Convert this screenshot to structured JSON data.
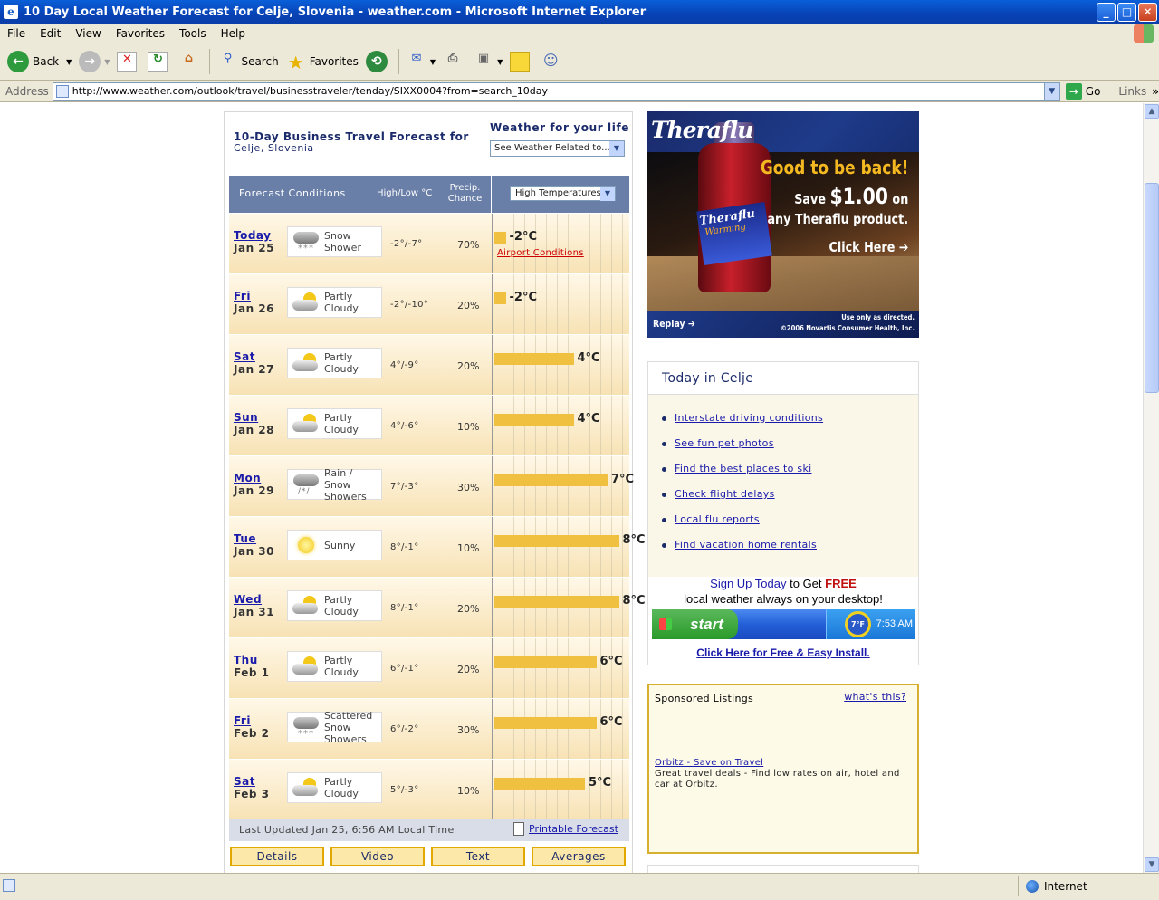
{
  "window": {
    "title": "10 Day Local Weather Forecast for Celje, Slovenia - weather.com - Microsoft Internet Explorer"
  },
  "menu": [
    "File",
    "Edit",
    "View",
    "Favorites",
    "Tools",
    "Help"
  ],
  "toolbar": {
    "back": "Back",
    "search": "Search",
    "favorites": "Favorites"
  },
  "address": {
    "label": "Address",
    "url": "http://www.weather.com/outlook/travel/businesstraveler/tenday/SIXX0004?from=search_10day",
    "go": "Go",
    "links": "Links"
  },
  "forecast": {
    "title": "10-Day Business Travel Forecast for",
    "location": "Celje, Slovenia",
    "wfl_title": "Weather for your life",
    "wfl_select": "See Weather Related to...",
    "header_conditions": "Forecast Conditions",
    "header_highlow": "High/Low °C",
    "header_precip": [
      "Precip.",
      "Chance"
    ],
    "temp_select": "High Temperatures",
    "airport_conditions": "Airport Conditions",
    "last_updated": "Last Updated Jan 25, 6:56 AM Local Time",
    "printable": "Printable Forecast",
    "buttons": [
      "Details",
      "Video",
      "Text",
      "Averages"
    ],
    "chart_scale_min": -3,
    "chart_scale_max": 9,
    "rows": [
      {
        "day": "Today",
        "date": "Jan 25",
        "cond": [
          "Snow",
          "Shower"
        ],
        "icon": "snow-shower-icon",
        "hl": "-2°/-7°",
        "precip": "70%",
        "high": -2,
        "temp_label": "-2°C"
      },
      {
        "day": "Fri",
        "date": "Jan 26",
        "cond": [
          "Partly",
          "Cloudy"
        ],
        "icon": "partly-cloudy-icon",
        "hl": "-2°/-10°",
        "precip": "20%",
        "high": -2,
        "temp_label": "-2°C"
      },
      {
        "day": "Sat",
        "date": "Jan 27",
        "cond": [
          "Partly",
          "Cloudy"
        ],
        "icon": "partly-cloudy-icon",
        "hl": "4°/-9°",
        "precip": "20%",
        "high": 4,
        "temp_label": "4°C"
      },
      {
        "day": "Sun",
        "date": "Jan 28",
        "cond": [
          "Partly",
          "Cloudy"
        ],
        "icon": "partly-cloudy-icon",
        "hl": "4°/-6°",
        "precip": "10%",
        "high": 4,
        "temp_label": "4°C"
      },
      {
        "day": "Mon",
        "date": "Jan 29",
        "cond": [
          "Rain /",
          "Snow",
          "Showers"
        ],
        "icon": "rain-snow-icon",
        "hl": "7°/-3°",
        "precip": "30%",
        "high": 7,
        "temp_label": "7°C"
      },
      {
        "day": "Tue",
        "date": "Jan 30",
        "cond": [
          "Sunny"
        ],
        "icon": "sunny-icon",
        "hl": "8°/-1°",
        "precip": "10%",
        "high": 8,
        "temp_label": "8°C"
      },
      {
        "day": "Wed",
        "date": "Jan 31",
        "cond": [
          "Partly",
          "Cloudy"
        ],
        "icon": "partly-cloudy-icon",
        "hl": "8°/-1°",
        "precip": "20%",
        "high": 8,
        "temp_label": "8°C"
      },
      {
        "day": "Thu",
        "date": "Feb 1",
        "cond": [
          "Partly",
          "Cloudy"
        ],
        "icon": "partly-cloudy-icon",
        "hl": "6°/-1°",
        "precip": "20%",
        "high": 6,
        "temp_label": "6°C"
      },
      {
        "day": "Fri",
        "date": "Feb 2",
        "cond": [
          "Scattered",
          "Snow",
          "Showers"
        ],
        "icon": "snow-shower-icon",
        "hl": "6°/-2°",
        "precip": "30%",
        "high": 6,
        "temp_label": "6°C"
      },
      {
        "day": "Sat",
        "date": "Feb 3",
        "cond": [
          "Partly",
          "Cloudy"
        ],
        "icon": "partly-cloudy-icon",
        "hl": "5°/-3°",
        "precip": "10%",
        "high": 5,
        "temp_label": "5°C"
      }
    ]
  },
  "ad": {
    "brand": "Theraflu",
    "headline": "Good to be back!",
    "save_pre": "Save",
    "save_amount": "$1.00",
    "save_post": "on",
    "product": "any Theraflu product.",
    "click": "Click Here",
    "bottle_brand": "Theraflu",
    "bottle_variant": "Warming",
    "replay": "Replay",
    "footer": [
      "Use only as directed.",
      "©2006 Novartis Consumer Health, Inc."
    ]
  },
  "today": {
    "title": "Today in Celje",
    "links": [
      "Interstate driving conditions",
      "See fun pet photos",
      "Find the best places to ski",
      "Check flight delays",
      "Local flu reports",
      "Find vacation home rentals"
    ],
    "signup_link": "Sign Up Today",
    "signup_mid": "to Get",
    "signup_free": "FREE",
    "signup_line2": "local weather always on your desktop!",
    "start": "start",
    "tray_temp": "7°F",
    "time": "7:53 AM",
    "install": "Click Here for Free & Easy Install."
  },
  "sponsored": {
    "title": "Sponsored Listings",
    "whats_this": "what's this?",
    "link": "Orbitz - Save on Travel",
    "desc": "Great travel deals - Find low rates on air, hotel and car at Orbitz."
  },
  "status": {
    "zone": "Internet"
  }
}
